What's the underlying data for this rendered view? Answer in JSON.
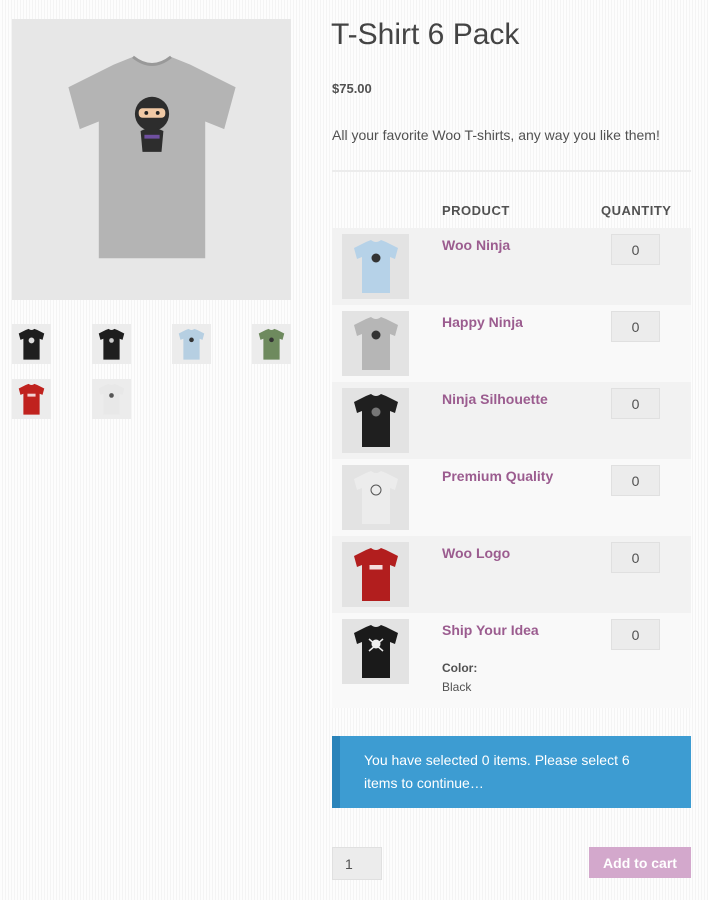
{
  "product": {
    "title": "T-Shirt 6 Pack",
    "price": "$75.00",
    "description": "All your favorite Woo T-shirts, any way you like them!"
  },
  "gallery": {
    "main_color": "#b4b4b4",
    "thumbs": [
      {
        "color": "#1e1e1e"
      },
      {
        "color": "#1e1e1e"
      },
      {
        "color": "#b6cfe2"
      },
      {
        "color": "#6e8a5e"
      },
      {
        "color": "#c0221e"
      },
      {
        "color": "#e8e8e8"
      }
    ]
  },
  "table": {
    "col_product": "PRODUCT",
    "col_quantity": "QUANTITY",
    "rows": [
      {
        "name": "Woo Ninja",
        "quantity": "0",
        "color": "#b6d2e8"
      },
      {
        "name": "Happy Ninja",
        "quantity": "0",
        "color": "#b6b6b6"
      },
      {
        "name": "Ninja Silhouette",
        "quantity": "0",
        "color": "#1f1f1f"
      },
      {
        "name": "Premium Quality",
        "quantity": "0",
        "color": "#ececec"
      },
      {
        "name": "Woo Logo",
        "quantity": "0",
        "color": "#b21e1e"
      },
      {
        "name": "Ship Your Idea",
        "quantity": "0",
        "color": "#1a1a1a",
        "attr_label": "Color:",
        "attr_value": "Black"
      }
    ]
  },
  "notice": {
    "text": "You have selected 0 items. Please select 6 items to continue…",
    "background": "#3d9cd2"
  },
  "cart": {
    "quantity": "1",
    "button_label": "Add to cart",
    "button_color": "#d3a8cc"
  },
  "colors": {
    "link": "#9b5c8f"
  }
}
